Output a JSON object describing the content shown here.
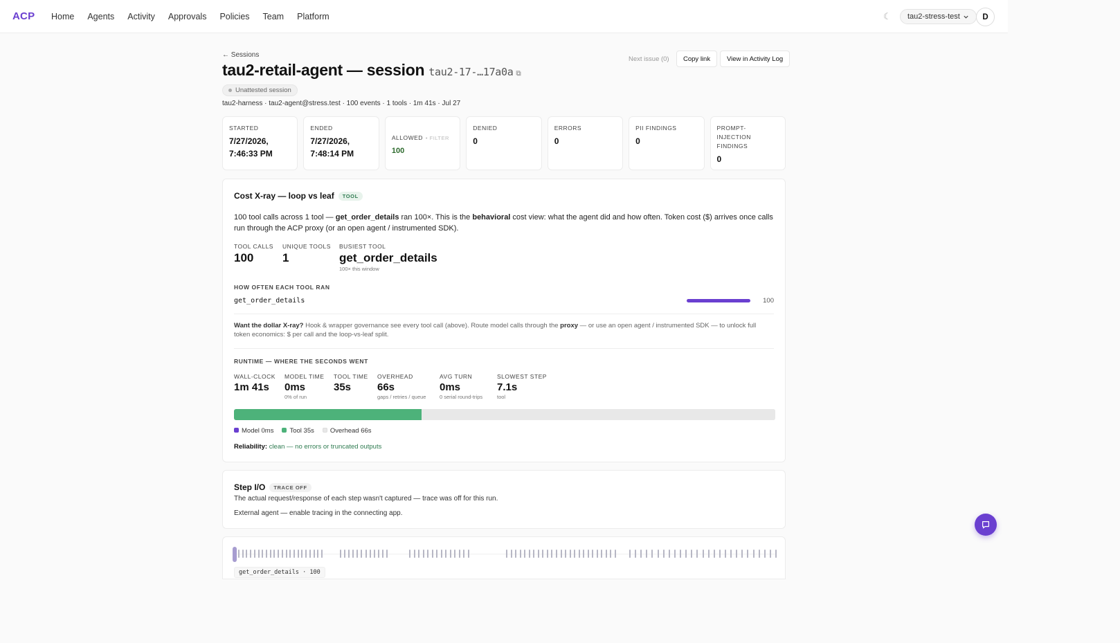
{
  "app": {
    "logo": "ACP",
    "nav": [
      "Home",
      "Agents",
      "Activity",
      "Approvals",
      "Policies",
      "Team",
      "Platform"
    ],
    "theme_icon": "moon-icon",
    "tenant": "tau2-stress-test",
    "avatar": "D"
  },
  "header": {
    "breadcrumb": "← Sessions",
    "title": "tau2-retail-agent — session",
    "session_id": "tau2-17-…17a0a",
    "copy_icon": "⧉",
    "badge": "Unattested session",
    "meta": "tau2-harness · tau2-agent@stress.test · 100 events · 1 tools · 1m 41s · Jul 27",
    "next_issue": "Next issue (0)",
    "copy_link": "Copy link",
    "view_activity": "View in Activity Log"
  },
  "stats": {
    "started_label": "STARTED",
    "started_value": "7/27/2026, 7:46:33 PM",
    "ended_label": "ENDED",
    "ended_value": "7/27/2026, 7:48:14 PM",
    "allowed_label": "ALLOWED",
    "allowed_filter": "• FILTER",
    "allowed_value": "100",
    "denied_label": "DENIED",
    "denied_value": "0",
    "errors_label": "ERRORS",
    "errors_value": "0",
    "pii_label": "PII FINDINGS",
    "pii_value": "0",
    "pi_label": "PROMPT-INJECTION FINDINGS",
    "pi_value": "0"
  },
  "xray": {
    "title": "Cost X-ray — loop vs leaf",
    "tag": "TOOL",
    "desc_1": "100 tool calls across 1 tool — ",
    "desc_tool": "get_order_details",
    "desc_2": " ran 100×. This is the ",
    "desc_behavioral": "behavioral",
    "desc_3": " cost view: what the agent did and how often. Token cost ($) arrives once calls run through the ACP proxy (or an open agent / instrumented SDK).",
    "tool_calls_label": "TOOL CALLS",
    "tool_calls_value": "100",
    "unique_tools_label": "UNIQUE TOOLS",
    "unique_tools_value": "1",
    "busiest_label": "BUSIEST TOOL",
    "busiest_value": "get_order_details",
    "busiest_sub": "100× this window",
    "how_often_label": "HOW OFTEN EACH TOOL RAN",
    "tool_rows": [
      {
        "name": "get_order_details",
        "count": "100",
        "fraction": 1.0
      }
    ],
    "note_bold": "Want the dollar X-ray?",
    "note_1": " Hook & wrapper governance see every tool call (above). Route model calls through the ",
    "note_proxy": "proxy",
    "note_2": " — or use an open agent / instrumented SDK — to unlock full token economics: $ per call and the loop-vs-leaf split.",
    "runtime_label": "RUNTIME — WHERE THE SECONDS WENT",
    "runtime": [
      {
        "label": "WALL-CLOCK",
        "value": "1m 41s",
        "sub": ""
      },
      {
        "label": "MODEL TIME",
        "value": "0ms",
        "sub": "0% of run"
      },
      {
        "label": "TOOL TIME",
        "value": "35s",
        "sub": ""
      },
      {
        "label": "OVERHEAD",
        "value": "66s",
        "sub": "gaps / retries / queue"
      },
      {
        "label": "AVG TURN",
        "value": "0ms",
        "sub": "0 serial round-trips"
      },
      {
        "label": "SLOWEST STEP",
        "value": "7.1s",
        "sub": "tool"
      }
    ],
    "runtime_split": {
      "model_s": 0,
      "tool_s": 35,
      "overhead_s": 66
    },
    "legend": [
      "Model 0ms",
      "Tool 35s",
      "Overhead 66s"
    ],
    "colors": {
      "model": "#6a3fd0",
      "tool": "#4db27a",
      "overhead": "#e8e8e8"
    },
    "reliability_label": "Reliability:",
    "reliability_value": "clean — no errors or truncated outputs"
  },
  "stepio": {
    "title": "Step I/O",
    "tag": "TRACE OFF",
    "line_1": "The actual request/response of each step wasn't captured — trace was off for this run.",
    "line_2": "External agent — enable tracing in the connecting app."
  },
  "timeline": {
    "label": "get_order_details · 100",
    "event_count": 100
  },
  "fab": {
    "icon": "chat-icon"
  }
}
